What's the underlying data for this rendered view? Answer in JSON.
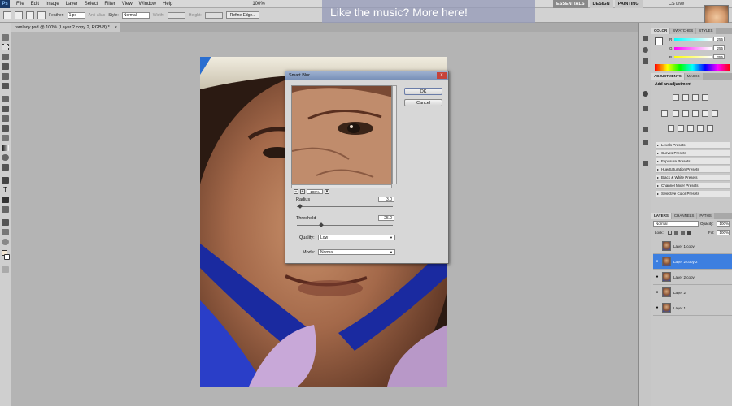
{
  "menubar": {
    "app_logo": "Ps",
    "items": [
      "File",
      "Edit",
      "Image",
      "Layer",
      "Select",
      "Filter",
      "View",
      "Window",
      "Help"
    ]
  },
  "options_bar": {
    "feather_label": "Feather:",
    "feather_value": "1 px",
    "anti_alias_label": "Anti-alias",
    "style_label": "Style:",
    "style_value": "Normal",
    "width_label": "Width:",
    "height_label": "Height:",
    "refine_edge_label": "Refine Edge...",
    "zoom_value": "100%"
  },
  "overlay_banner": {
    "text": "Like the music? More here!"
  },
  "workspace": {
    "buttons": [
      "ESSENTIALS",
      "DESIGN",
      "PAINTING"
    ],
    "active": "ESSENTIALS",
    "cs_live": "CS Live"
  },
  "document_tab": {
    "title": "ramlady.psd @ 100% (Layer 2 copy 2, RGB/8) *"
  },
  "dialog": {
    "title": "Smart Blur",
    "ok_label": "OK",
    "cancel_label": "Cancel",
    "zoom_value": "100%",
    "radius_label": "Radius",
    "radius_value": "3.0",
    "radius_fraction": 0.03,
    "threshold_label": "Threshold",
    "threshold_value": "25.0",
    "threshold_fraction": 0.25,
    "quality_label": "Quality:",
    "quality_value": "Low",
    "mode_label": "Mode:",
    "mode_value": "Normal"
  },
  "color_panel": {
    "tabs": [
      "COLOR",
      "SWATCHES",
      "STYLES"
    ],
    "active_tab": "COLOR",
    "channels": [
      {
        "label": "R",
        "value": "255"
      },
      {
        "label": "G",
        "value": "255"
      },
      {
        "label": "B",
        "value": "255"
      }
    ]
  },
  "adjustments_panel": {
    "tabs": [
      "ADJUSTMENTS",
      "MASKS"
    ],
    "active_tab": "ADJUSTMENTS",
    "heading": "Add an adjustment",
    "presets": [
      "Levels Presets",
      "Curves Presets",
      "Exposure Presets",
      "Hue/Saturation Presets",
      "Black & White Presets",
      "Channel Mixer Presets",
      "Selective Color Presets"
    ]
  },
  "layers_panel": {
    "tabs": [
      "LAYERS",
      "CHANNELS",
      "PATHS"
    ],
    "active_tab": "LAYERS",
    "blend_mode": "Normal",
    "opacity_label": "Opacity:",
    "opacity_value": "100%",
    "lock_label": "Lock:",
    "fill_label": "Fill:",
    "fill_value": "100%",
    "layers": [
      {
        "name": "Layer 1 copy",
        "visible": false,
        "selected": false
      },
      {
        "name": "Layer 2 copy 2",
        "visible": true,
        "selected": true
      },
      {
        "name": "Layer 2 copy",
        "visible": true,
        "selected": false
      },
      {
        "name": "Layer 2",
        "visible": true,
        "selected": false
      },
      {
        "name": "Layer 1",
        "visible": true,
        "selected": false
      }
    ]
  },
  "colors": {
    "selection_blue": "#3d7fe0",
    "ok_border": "#6a7ca8",
    "banner_bg": "#969bb9"
  }
}
